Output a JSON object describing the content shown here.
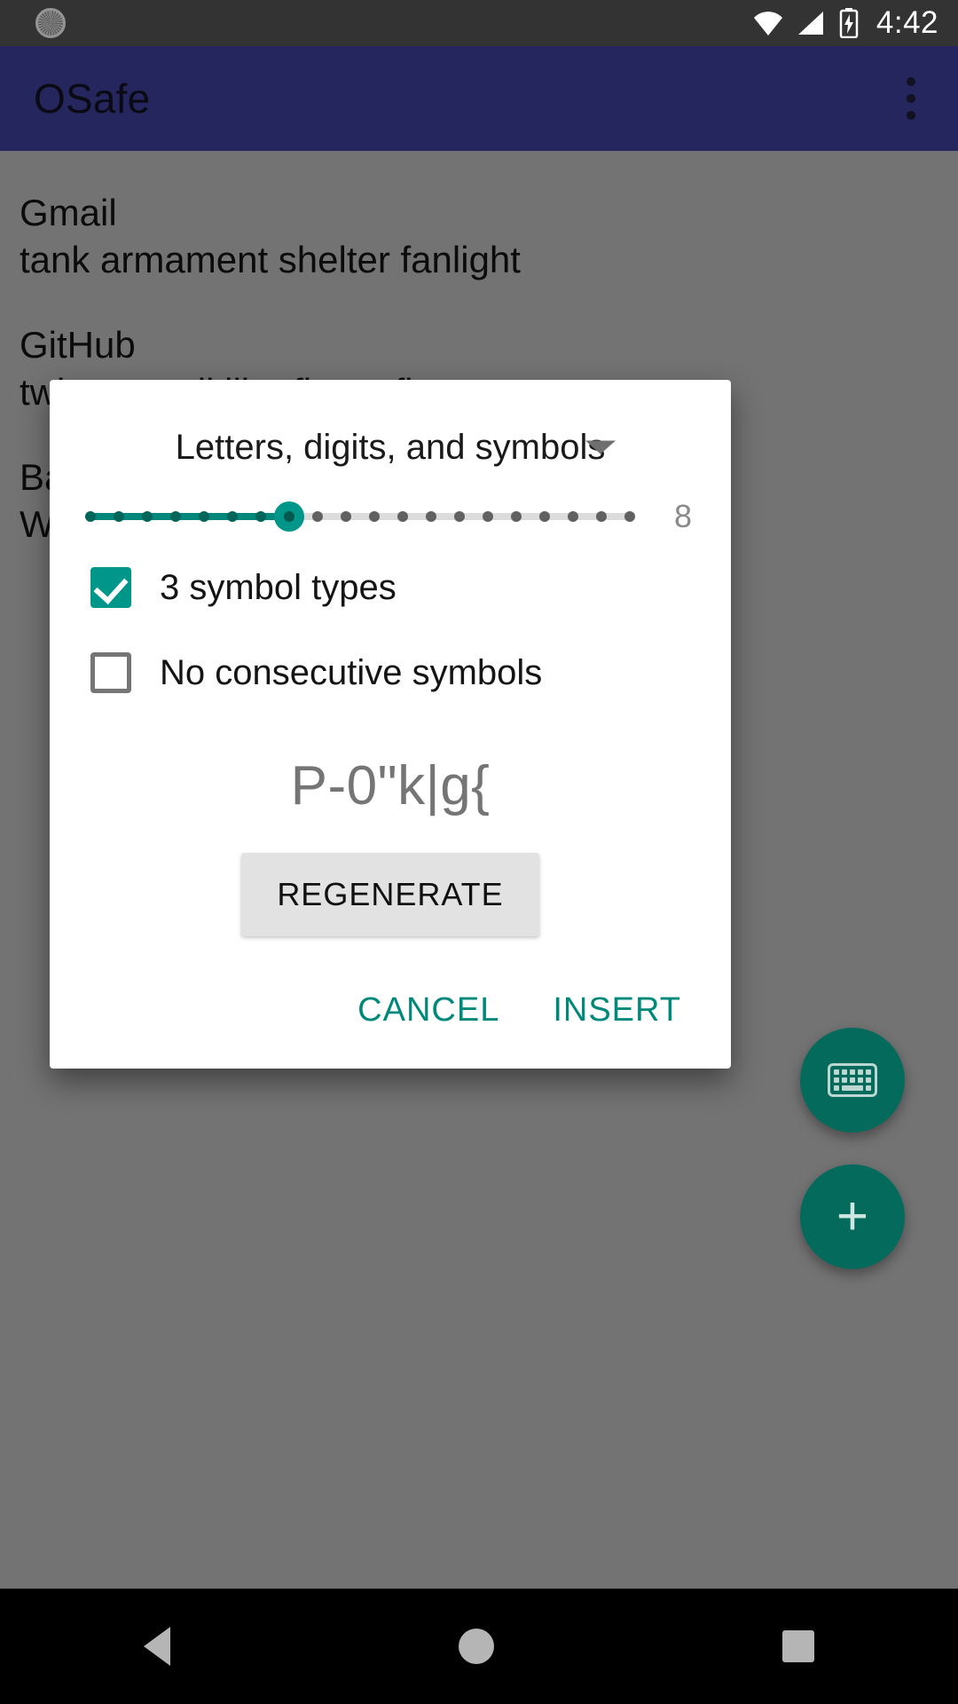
{
  "status_bar": {
    "time": "4:42",
    "icons": [
      "sync-icon",
      "wifi-icon",
      "signal-icon",
      "battery-charging-icon"
    ]
  },
  "app_bar": {
    "title": "OSafe",
    "overflow_icon": "overflow-menu-icon"
  },
  "list": {
    "entries": [
      {
        "title": "Gmail",
        "subtitle": "tank armament shelter fanlight"
      },
      {
        "title": "GitHub",
        "subtitle": "twine weedkiller flavor flour"
      },
      {
        "title": "Ba",
        "subtitle": "W"
      }
    ]
  },
  "fabs": [
    {
      "name": "keyboard-fab",
      "icon": "keyboard-icon"
    },
    {
      "name": "add-fab",
      "icon": "plus-icon",
      "label": "+"
    }
  ],
  "dialog": {
    "charset_spinner": {
      "selected": "Letters, digits, and symbols",
      "caret_icon": "chevron-down-icon"
    },
    "length_slider": {
      "value": 8,
      "value_label": "8",
      "min": 1,
      "max": 20,
      "ticks": 20,
      "fill_color": "#00897b",
      "thumb_color": "#00968a",
      "track_color": "#dcdcdc"
    },
    "checkboxes": [
      {
        "label": "3 symbol types",
        "checked": true
      },
      {
        "label": "No consecutive symbols",
        "checked": false
      }
    ],
    "generated_password": "P-0\"k|g{",
    "regenerate_label": "REGENERATE",
    "actions": [
      {
        "label": "CANCEL",
        "name": "cancel-button"
      },
      {
        "label": "INSERT",
        "name": "insert-button"
      }
    ],
    "accent_color": "#00897b"
  },
  "nav_bar": {
    "items": [
      "back-icon",
      "home-icon",
      "recents-icon"
    ]
  }
}
